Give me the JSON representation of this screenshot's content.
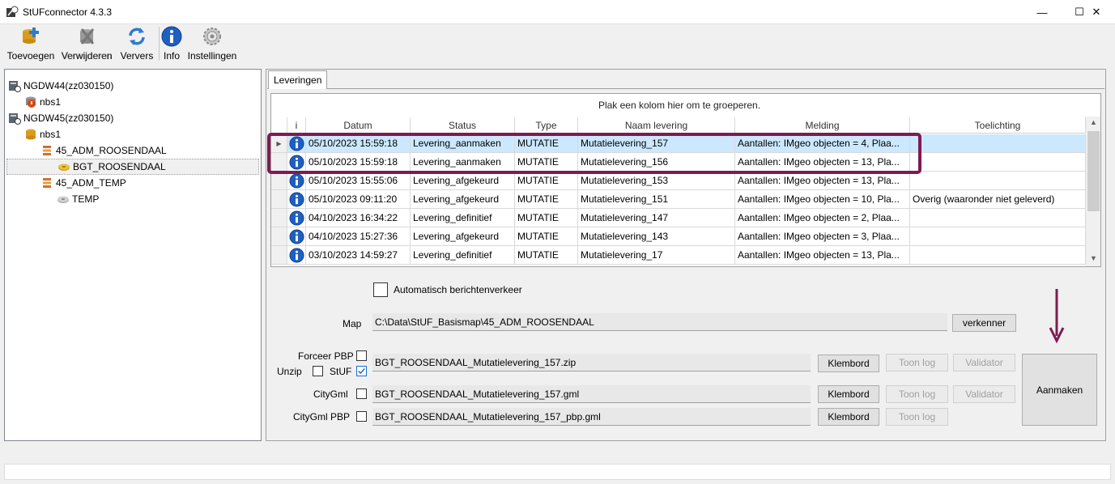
{
  "window": {
    "title": "StUFconnector 4.3.3",
    "min": "—",
    "max": "☐",
    "close": "✕"
  },
  "toolbar": {
    "add": "Toevoegen",
    "remove": "Verwijderen",
    "refresh": "Ververs",
    "info": "Info",
    "settings": "Instellingen"
  },
  "tree": {
    "items": [
      {
        "label": "NGDW44(zz030150)"
      },
      {
        "label": "nbs1"
      },
      {
        "label": "NGDW45(zz030150)"
      },
      {
        "label": "nbs1"
      },
      {
        "label": "45_ADM_ROOSENDAAL"
      },
      {
        "label": "BGT_ROOSENDAAL"
      },
      {
        "label": "45_ADM_TEMP"
      },
      {
        "label": "TEMP"
      }
    ]
  },
  "tab": {
    "label": "Leveringen"
  },
  "grid": {
    "group_hint": "Plak een kolom hier om te groeperen.",
    "headers": [
      "i",
      "Datum",
      "Status",
      "Type",
      "Naam levering",
      "Melding",
      "Toelichting"
    ],
    "rows": [
      {
        "datum": "05/10/2023 15:59:18",
        "status": "Levering_aanmaken",
        "type": "MUTATIE",
        "naam": "Mutatielevering_157",
        "melding": "Aantallen:  IMgeo objecten = 4,  Plaa...",
        "toelichting": ""
      },
      {
        "datum": "05/10/2023 15:59:18",
        "status": "Levering_aanmaken",
        "type": "MUTATIE",
        "naam": "Mutatielevering_156",
        "melding": "Aantallen:  IMgeo objecten = 13,  Pla...",
        "toelichting": ""
      },
      {
        "datum": "05/10/2023 15:55:06",
        "status": "Levering_afgekeurd",
        "type": "MUTATIE",
        "naam": "Mutatielevering_153",
        "melding": "Aantallen:  IMgeo objecten = 13,  Pla...",
        "toelichting": ""
      },
      {
        "datum": "05/10/2023 09:11:20",
        "status": "Levering_afgekeurd",
        "type": "MUTATIE",
        "naam": "Mutatielevering_151",
        "melding": "Aantallen:  IMgeo objecten = 10,  Pla...",
        "toelichting": "Overig (waaronder niet geleverd)"
      },
      {
        "datum": "04/10/2023 16:34:22",
        "status": "Levering_definitief",
        "type": "MUTATIE",
        "naam": "Mutatielevering_147",
        "melding": "Aantallen:  IMgeo objecten = 2,  Plaa...",
        "toelichting": ""
      },
      {
        "datum": "04/10/2023 15:27:36",
        "status": "Levering_afgekeurd",
        "type": "MUTATIE",
        "naam": "Mutatielevering_143",
        "melding": "Aantallen:  IMgeo objecten = 3,  Plaa...",
        "toelichting": ""
      },
      {
        "datum": "03/10/2023 14:59:27",
        "status": "Levering_definitief",
        "type": "MUTATIE",
        "naam": "Mutatielevering_17",
        "melding": "Aantallen:  IMgeo objecten = 13,  Pla...",
        "toelichting": ""
      }
    ],
    "selected_row_marker": "▶"
  },
  "form": {
    "auto_label": "Automatisch berichtenverkeer",
    "map_label": "Map",
    "map_value": "C:\\Data\\StUF_Basismap\\45_ADM_ROOSENDAAL",
    "explorer_button": "verkenner",
    "forceer_label": "Forceer PBP",
    "unzip_label": "Unzip",
    "stuf_label": "StUF",
    "stuf_value": "BGT_ROOSENDAAL_Mutatielevering_157.zip",
    "citygml_label": "CityGml",
    "citygml_value": "BGT_ROOSENDAAL_Mutatielevering_157.gml",
    "citygml_pbp_label": "CityGml PBP",
    "citygml_pbp_value": "BGT_ROOSENDAAL_Mutatielevering_157_pbp.gml",
    "clipboard_button": "Klembord",
    "show_log_button": "Toon log",
    "validator_button": "Validator",
    "create_button": "Aanmaken"
  },
  "colors": {
    "highlight": "#7d1b52",
    "selection": "#cce8ff",
    "info_blue": "#1f5fbf"
  }
}
